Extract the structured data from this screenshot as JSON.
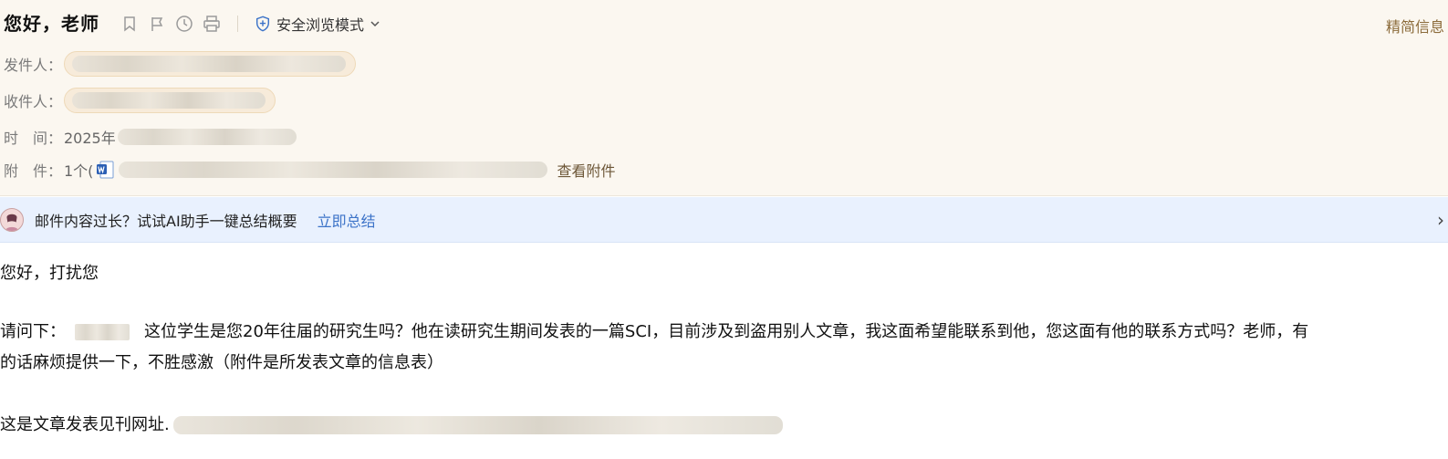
{
  "header": {
    "subject": "您好，老师",
    "safe_mode_label": "安全浏览模式",
    "simple_info_label": "精简信息",
    "sender_label": "发件人：",
    "recipient_label": "收件人：",
    "time_label": "时　间：",
    "time_value_prefix": "2025年",
    "attachment_label": "附　件：",
    "attachment_count_prefix": "1个(",
    "view_attachment_label": "查看附件"
  },
  "icons": {
    "bookmark": "bookmark-icon",
    "flag": "flag-icon",
    "clock": "clock-icon",
    "print": "print-icon",
    "shield": "shield-icon",
    "chevron": "chevron-down-icon",
    "word": "word-file-icon"
  },
  "ai_banner": {
    "text": "邮件内容过长？试试AI助手一键总结概要",
    "action_label": "立即总结",
    "arrow": "›"
  },
  "body": {
    "greeting": "您好，打扰您",
    "para1_line1_prefix": "请问下：",
    "para1_line1_rest": "这位学生是您20年往届的研究生吗？他在读研究生期间发表的一篇SCI，目前涉及到盗用别人文章，我这面希望能联系到他，您这面有他的联系方式吗？老师，有",
    "para1_line2": "的话麻烦提供一下，不胜感激（附件是所发表文章的信息表）",
    "para2_prefix": "这是文章发表见刊网址."
  },
  "colors": {
    "header_bg": "#fbf7f0",
    "banner_bg": "#e9f1fe",
    "link_blue": "#3c73c8",
    "link_brown": "#8b6b3a"
  }
}
